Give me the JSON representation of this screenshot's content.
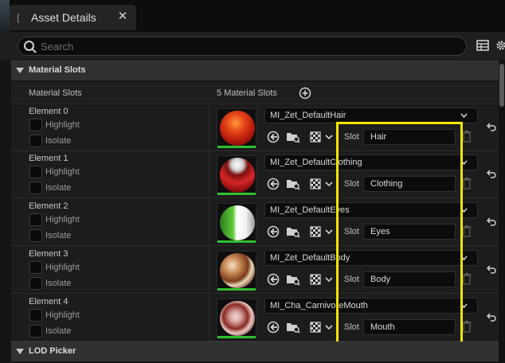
{
  "tab": {
    "title": "Asset Details",
    "close": "✕"
  },
  "search": {
    "placeholder": "Search"
  },
  "sections": {
    "material_slots": "Material Slots",
    "lod_picker": "LOD Picker"
  },
  "header": {
    "column_label": "Material Slots",
    "count": "5 Material Slots"
  },
  "labels": {
    "highlight": "Highlight",
    "isolate": "Isolate",
    "slot": "Slot"
  },
  "colors": {
    "highlight_box": "#f5e400",
    "valid_bar": "#2fbf32",
    "background": "#1c1c1c"
  },
  "elements": [
    {
      "name": "Element 0",
      "material": "MI_Zet_DefaultHair",
      "slot": "Hair"
    },
    {
      "name": "Element 1",
      "material": "MI_Zet_DefaultClothing",
      "slot": "Clothing"
    },
    {
      "name": "Element 2",
      "material": "MI_Zet_DefaultEyes",
      "slot": "Eyes"
    },
    {
      "name": "Element 3",
      "material": "MI_Zet_DefaultBody",
      "slot": "Body"
    },
    {
      "name": "Element 4",
      "material": "MI_Cha_CarnivoreMouth",
      "slot": "Mouth"
    }
  ]
}
